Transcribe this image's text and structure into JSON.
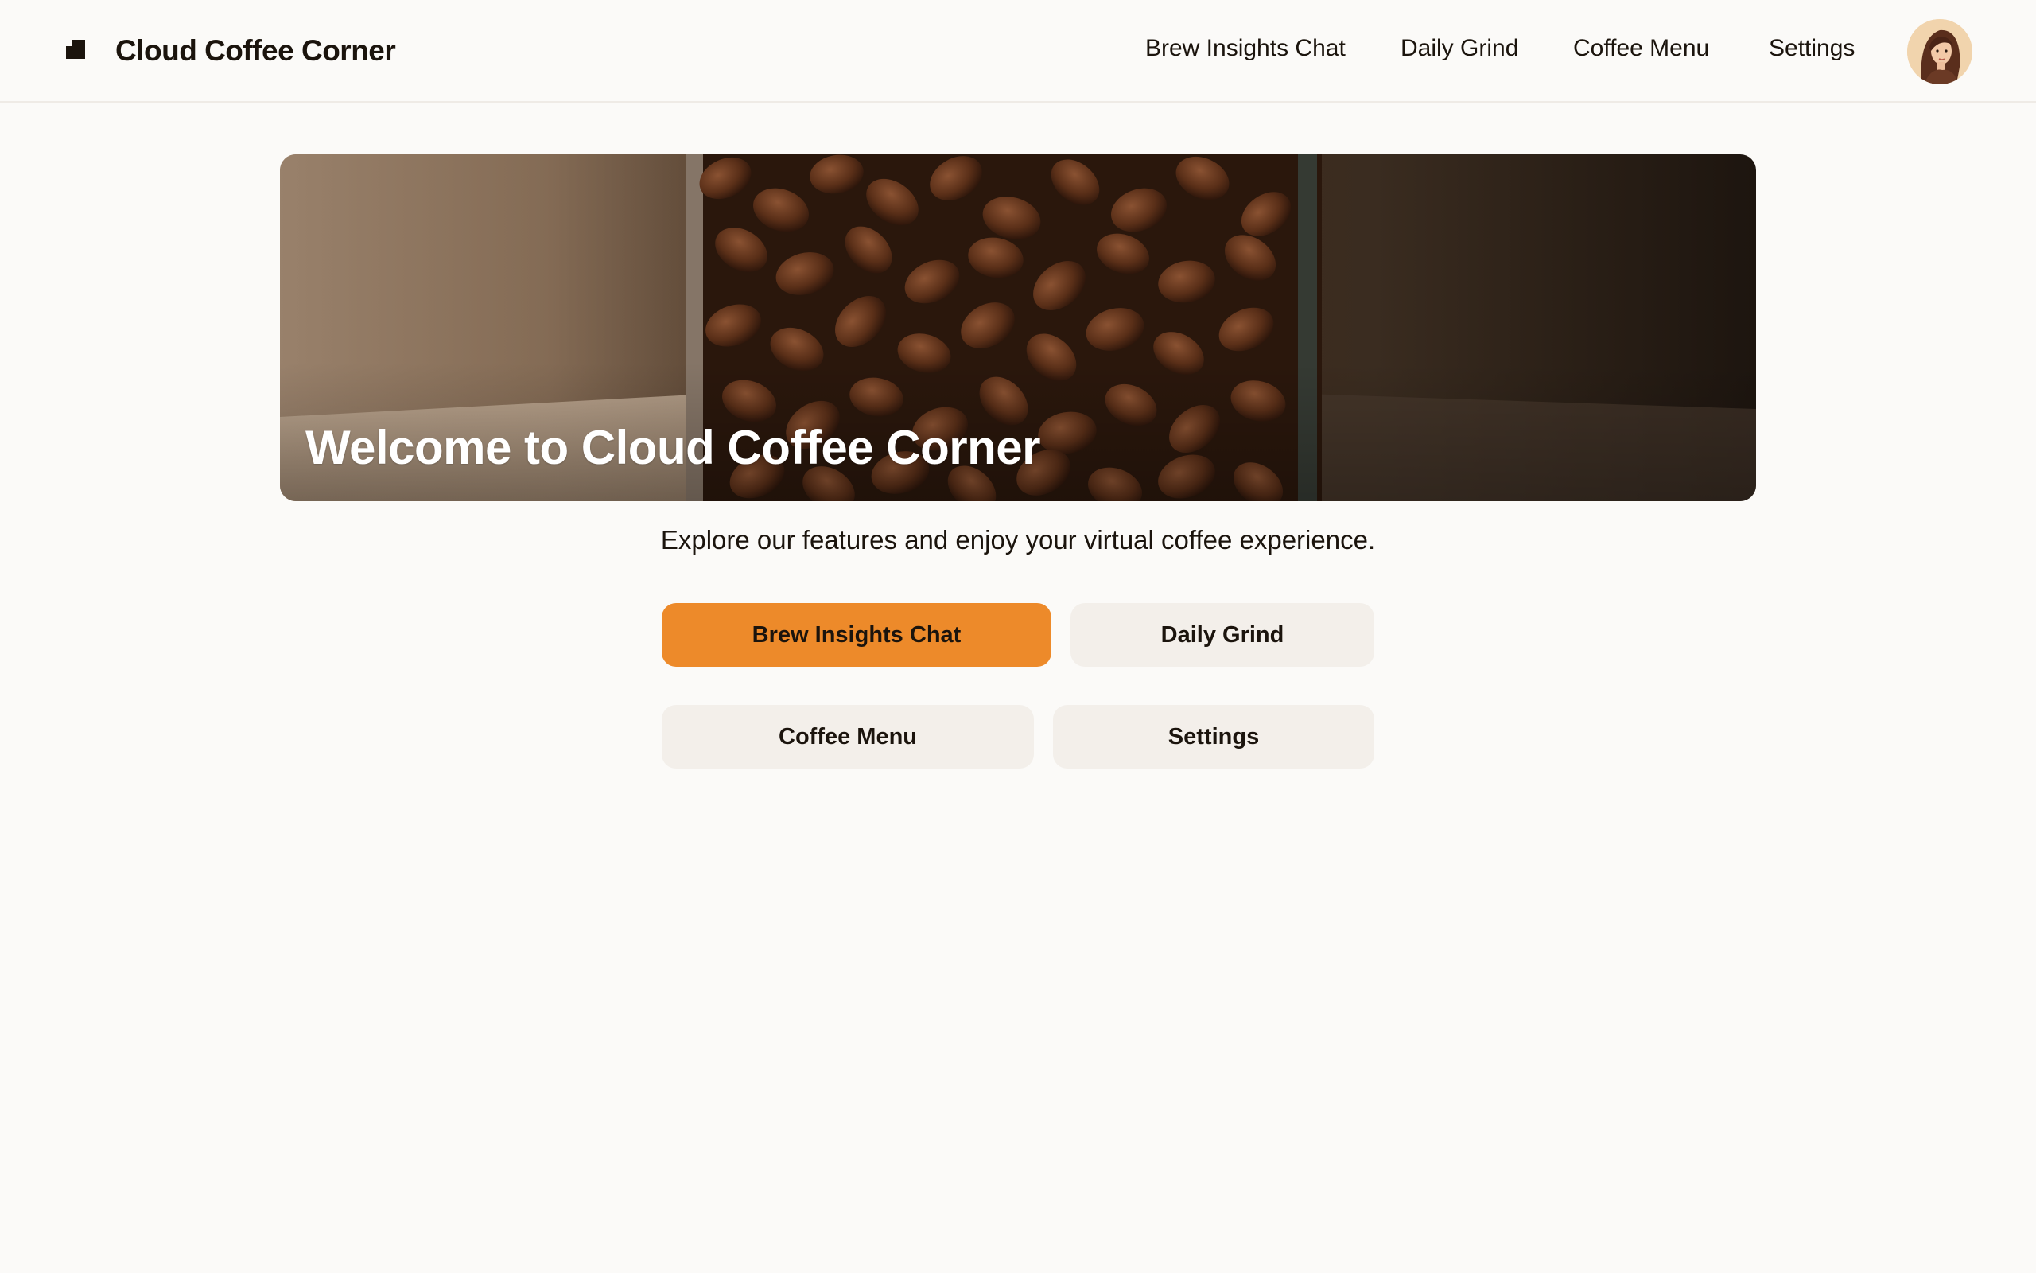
{
  "header": {
    "app_name": "Cloud Coffee Corner",
    "nav": [
      {
        "label": "Brew Insights Chat"
      },
      {
        "label": "Daily Grind"
      },
      {
        "label": "Coffee Menu"
      },
      {
        "label": "Settings"
      }
    ],
    "avatar_icon": "user-avatar"
  },
  "hero": {
    "title": "Welcome to Cloud Coffee Corner"
  },
  "main": {
    "subtitle": "Explore our features and enjoy your virtual coffee experience.",
    "buttons": [
      {
        "label": "Brew Insights Chat"
      },
      {
        "label": "Daily Grind"
      },
      {
        "label": "Coffee Menu"
      },
      {
        "label": "Settings"
      }
    ]
  },
  "colors": {
    "accent": "#ed8a2a",
    "background": "#fbfaf8",
    "secondary_button": "#f3efea",
    "text": "#1b140d"
  }
}
